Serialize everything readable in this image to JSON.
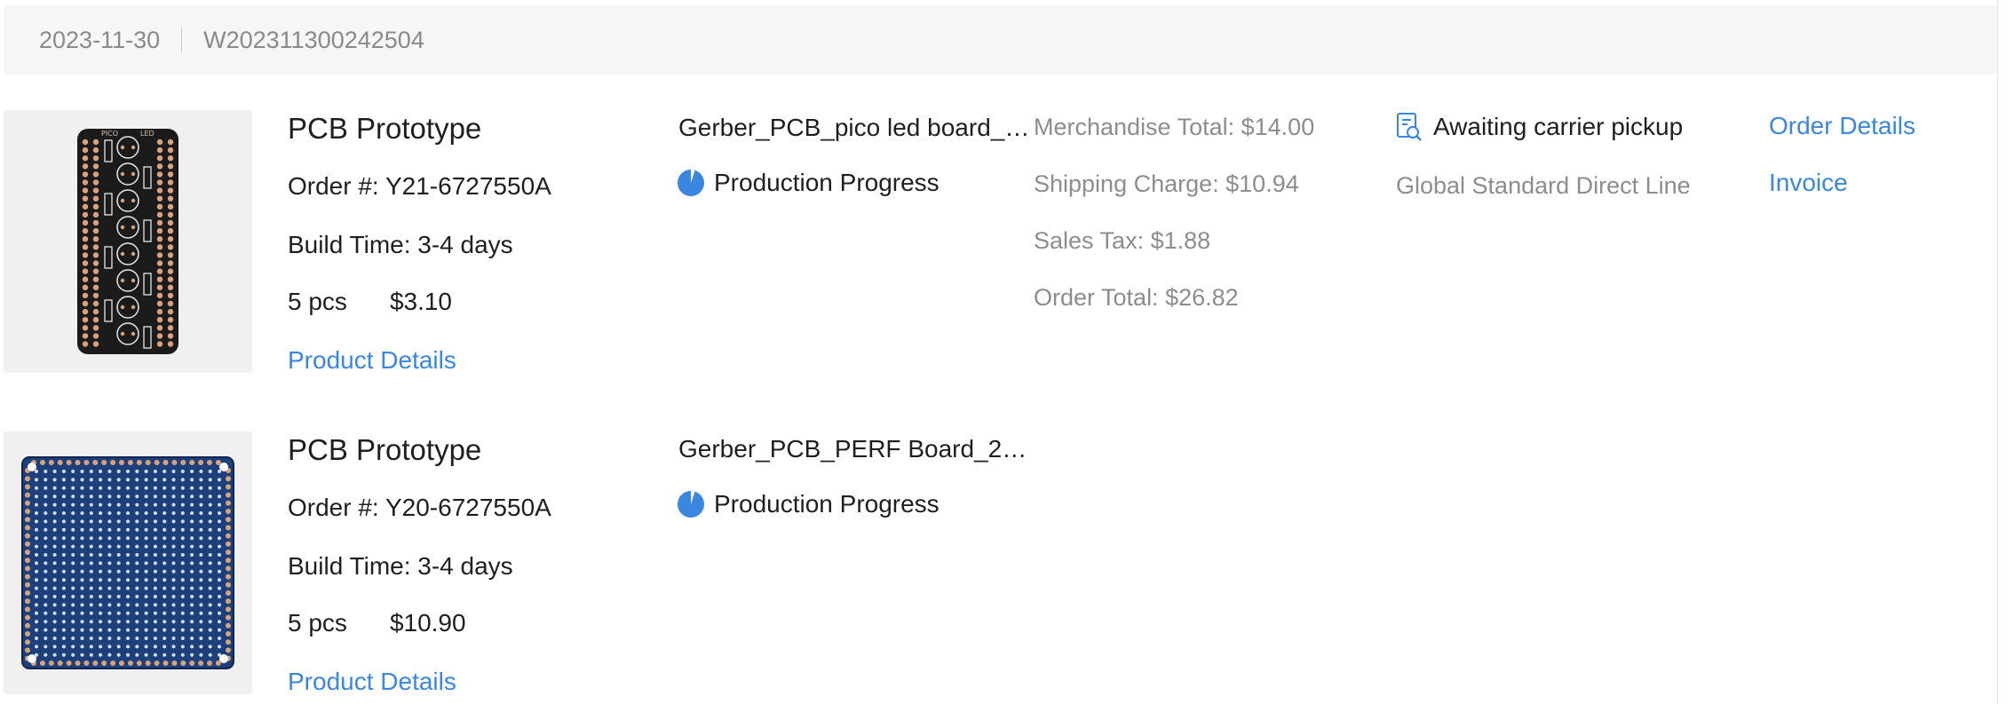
{
  "order": {
    "date": "2023-11-30",
    "number": "W202311300242504",
    "merchandise_total": "Merchandise Total: $14.00",
    "shipping_charge": "Shipping Charge: $10.94",
    "sales_tax": "Sales Tax: $1.88",
    "order_total": "Order Total: $26.82",
    "status": "Awaiting carrier pickup",
    "shipping_method": "Global Standard Direct Line",
    "order_details_label": "Order Details",
    "invoice_label": "Invoice"
  },
  "items": [
    {
      "title": "PCB Prototype",
      "order_label": "Order #:",
      "order_no": "Y21-6727550A",
      "build_time": "Build Time: 3-4 days",
      "qty": "5 pcs",
      "price": "$3.10",
      "details_label": "Product Details",
      "file_name": "Gerber_PCB_pico led board_…",
      "progress_label": "Production Progress",
      "thumb_icons": [
        "PICO",
        "LED"
      ]
    },
    {
      "title": "PCB Prototype",
      "order_label": "Order #:",
      "order_no": "Y20-6727550A",
      "build_time": "Build Time: 3-4 days",
      "qty": "5 pcs",
      "price": "$10.90",
      "details_label": "Product Details",
      "file_name": "Gerber_PCB_PERF Board_20…",
      "progress_label": "Production Progress"
    }
  ],
  "colors": {
    "link": "#3b86de",
    "muted": "#8d8d8d",
    "header_bg": "#f5f6f7",
    "pcb_black": "#1b1b1b",
    "pcb_blue": "#1d3f7a"
  },
  "icons": {
    "progress": "pie-progress-icon",
    "status": "document-search-icon"
  }
}
